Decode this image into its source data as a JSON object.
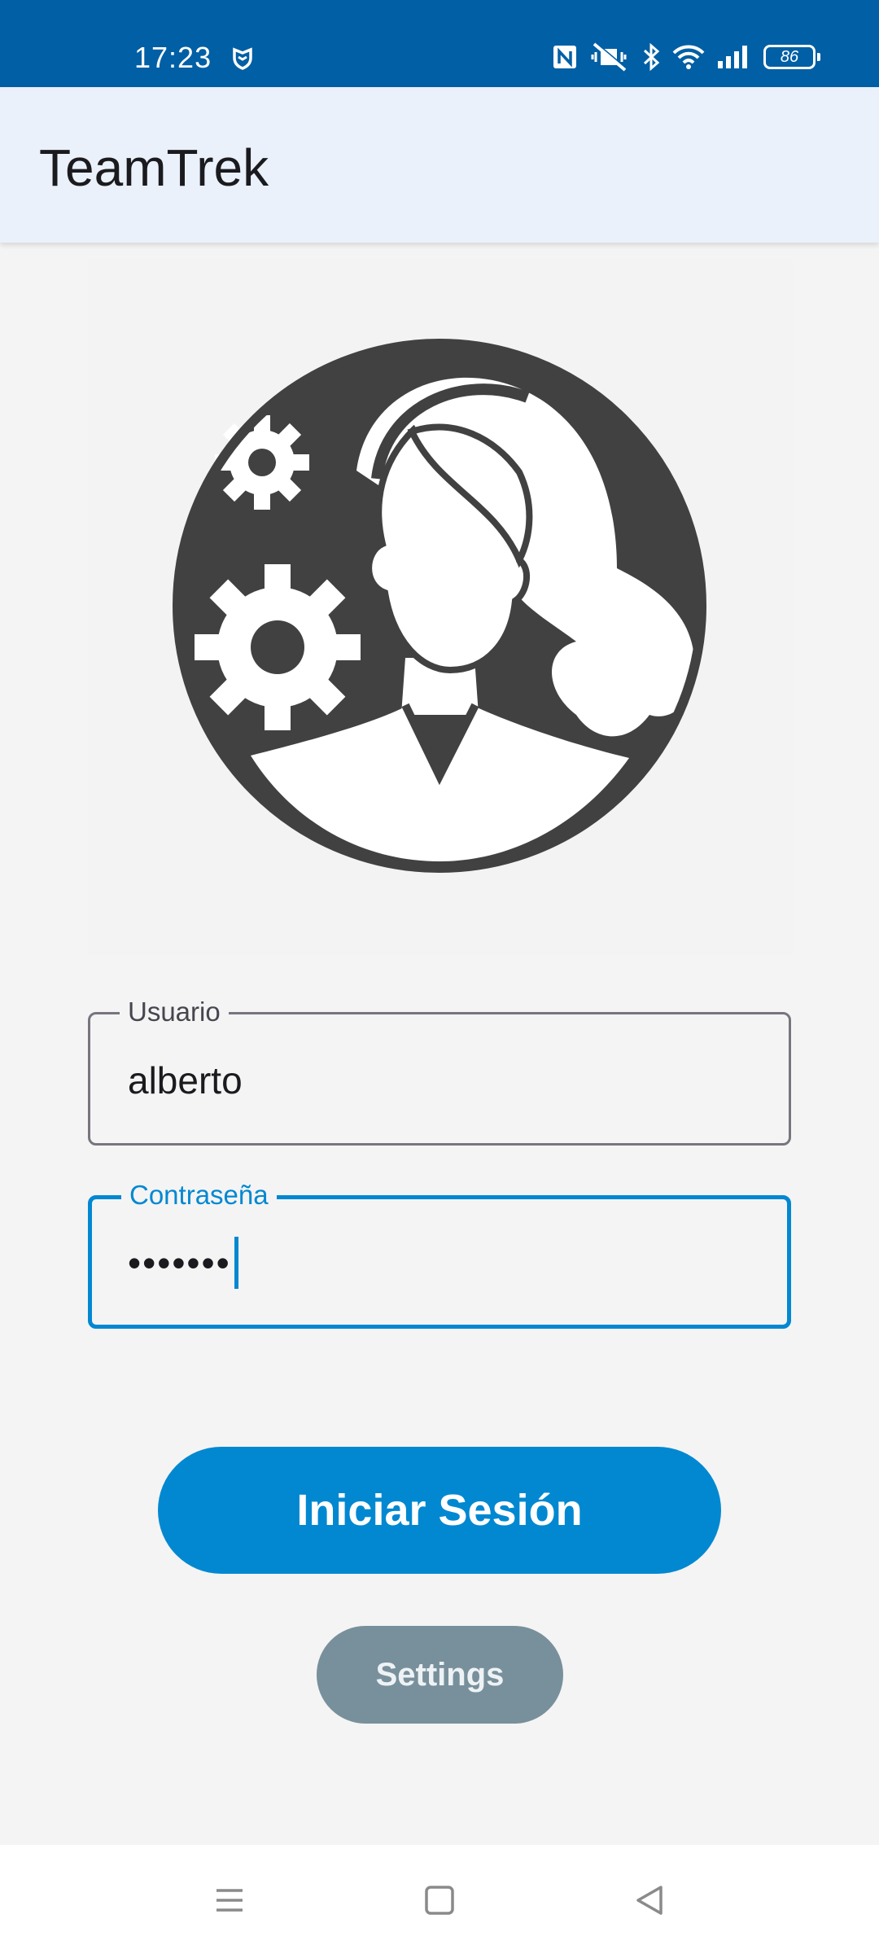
{
  "status_bar": {
    "time": "17:23",
    "icons": [
      "shield-icon",
      "nfc-icon",
      "vibrate-muted-icon",
      "bluetooth-icon",
      "wifi-icon",
      "signal-icon",
      "battery-icon"
    ],
    "battery_level": "86",
    "background": "#005fa5"
  },
  "app_bar": {
    "title": "TeamTrek",
    "background": "#eaf1fa"
  },
  "logo": {
    "icon": "woman-with-gears-logo"
  },
  "form": {
    "username": {
      "label": "Usuario",
      "value": "alberto"
    },
    "password": {
      "label": "Contraseña",
      "value": "•••••••"
    }
  },
  "buttons": {
    "login_label": "Iniciar Sesión",
    "settings_label": "Settings"
  },
  "colors": {
    "accent": "#0288d1",
    "secondary_button": "#78909c"
  },
  "nav_bar": {
    "icons": [
      "menu-icon",
      "home-icon",
      "back-icon"
    ]
  }
}
